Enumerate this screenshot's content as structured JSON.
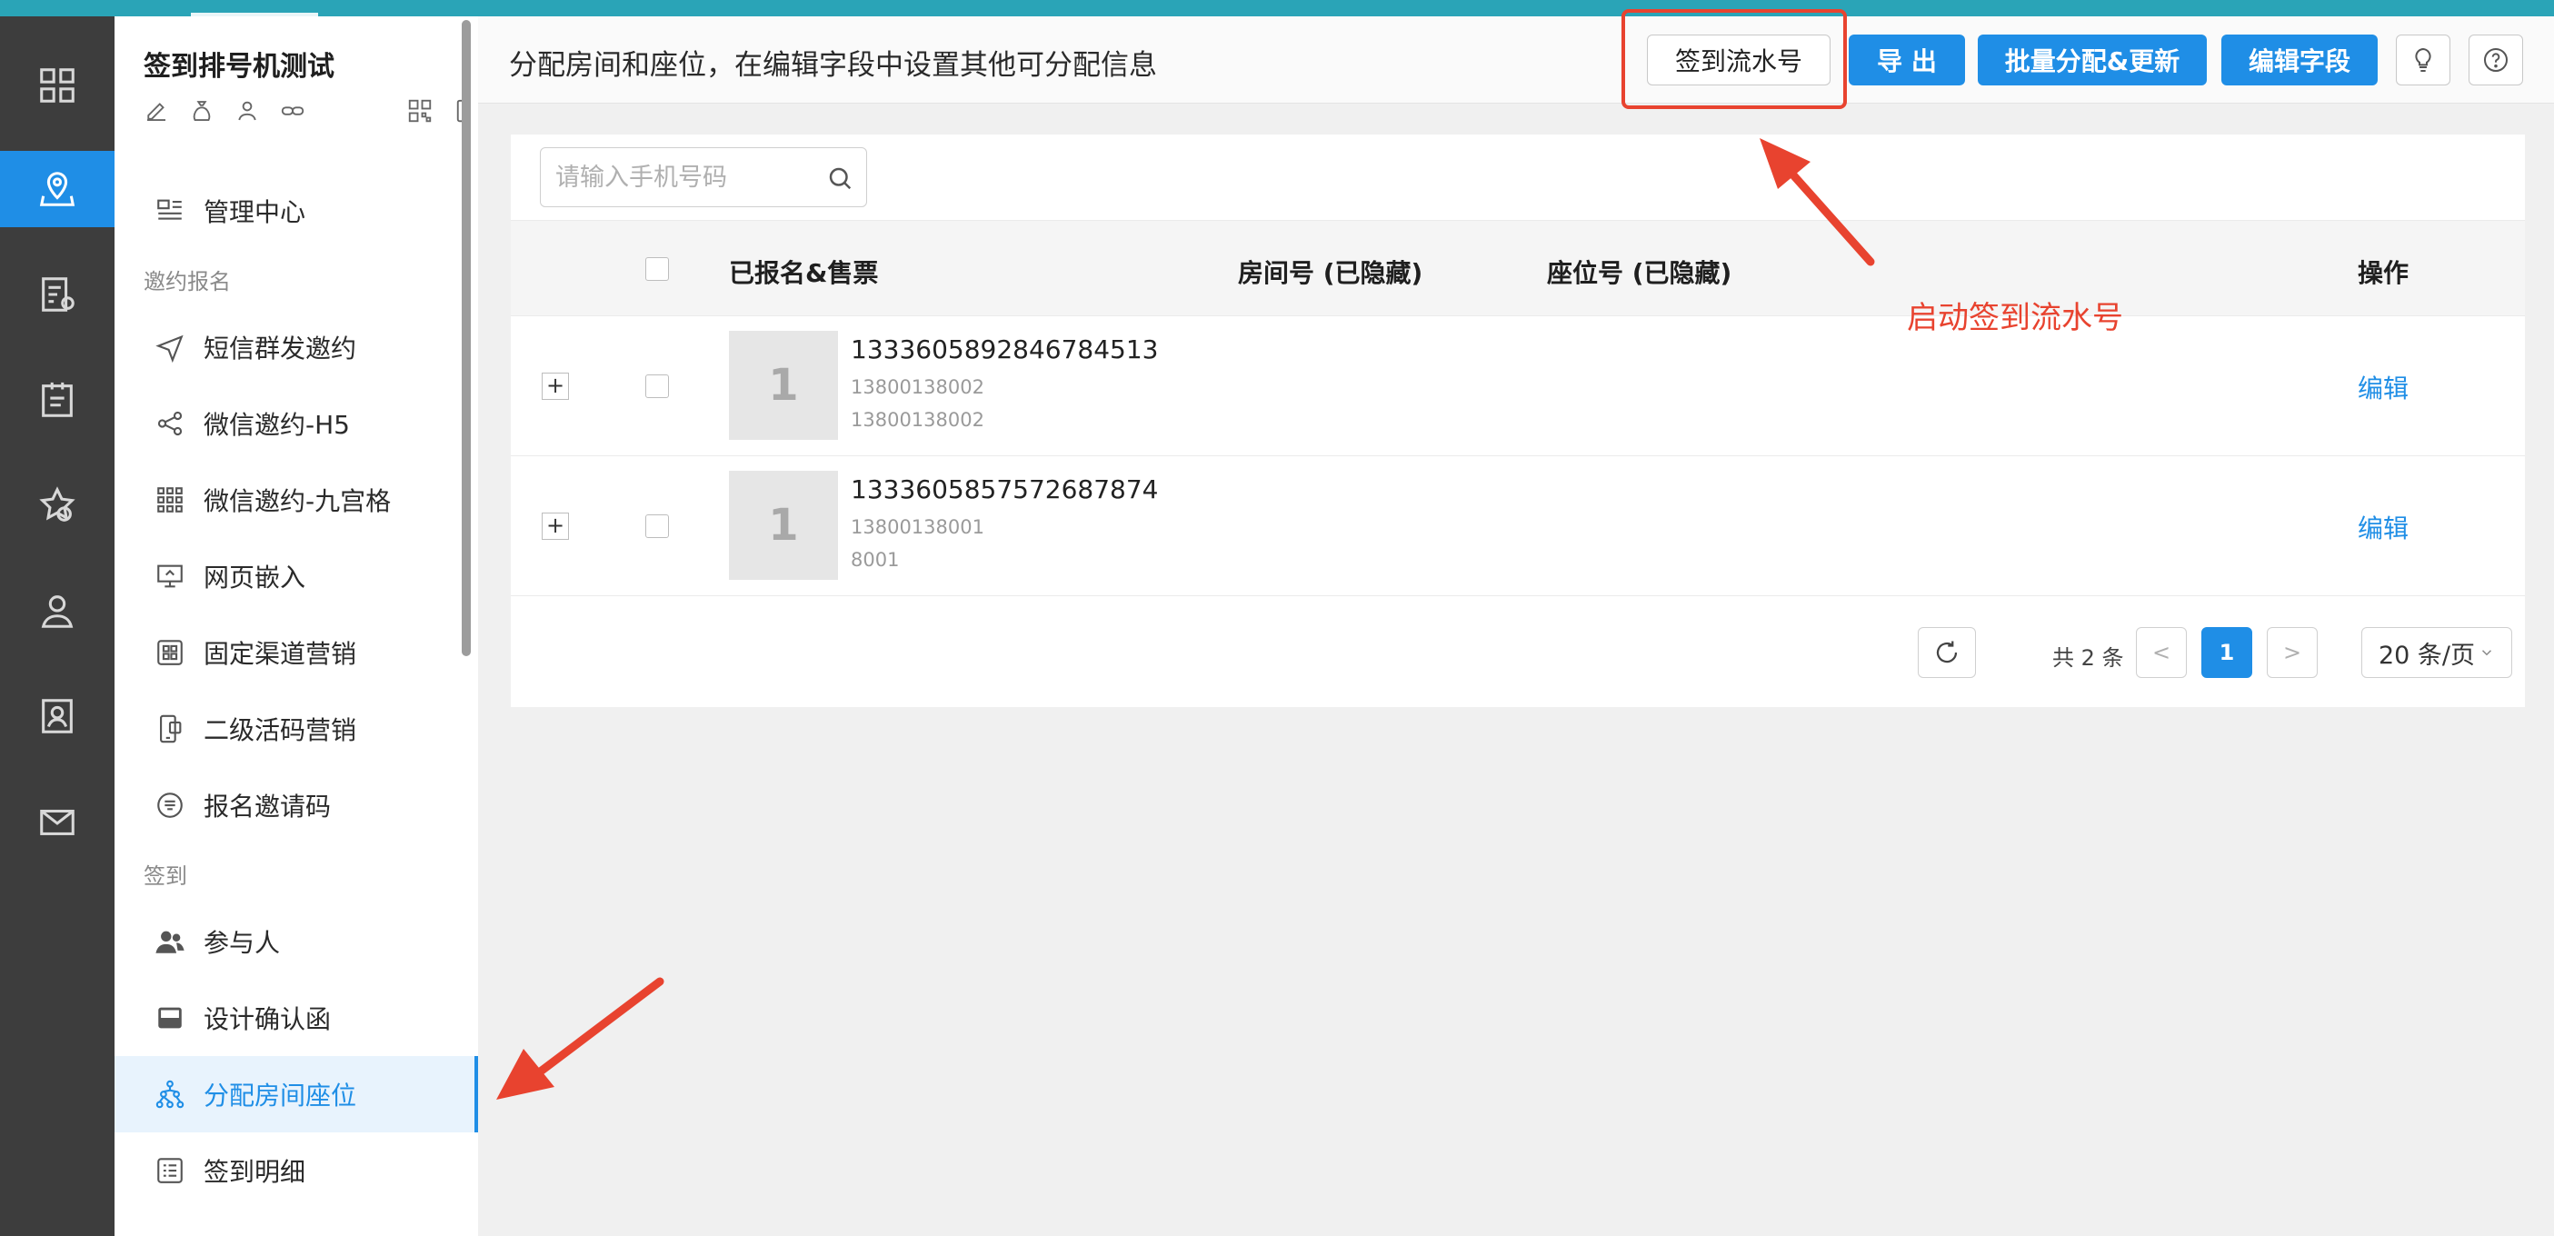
{
  "sidebar": {
    "project_title": "签到排号机测试",
    "items": [
      {
        "label": "管理中心"
      },
      {
        "label": "短信群发邀约"
      },
      {
        "label": "微信邀约-H5"
      },
      {
        "label": "微信邀约-九宫格"
      },
      {
        "label": "网页嵌入"
      },
      {
        "label": "固定渠道营销"
      },
      {
        "label": "二级活码营销"
      },
      {
        "label": "报名邀请码"
      },
      {
        "label": "参与人"
      },
      {
        "label": "设计确认函"
      },
      {
        "label": "分配房间座位"
      },
      {
        "label": "签到明细"
      }
    ],
    "sections": [
      "邀约报名",
      "签到"
    ],
    "active_color": "#1f8ee6"
  },
  "header": {
    "title": "分配房间和座位，在编辑字段中设置其他可分配信息",
    "buttons": {
      "checkin_serial": "签到流水号",
      "export": "导 出",
      "batch": "批量分配&更新",
      "edit_fields": "编辑字段"
    },
    "icons": [
      "lightbulb-icon",
      "help-icon"
    ]
  },
  "search": {
    "placeholder": "请输入手机号码"
  },
  "table": {
    "columns": [
      "已报名&售票",
      "房间号 (已隐藏)",
      "座位号 (已隐藏)",
      "操作"
    ],
    "rows": [
      {
        "thumb": "1",
        "id": "1333605892846784513",
        "line1": "13800138002",
        "line2": "13800138002",
        "action": "编辑"
      },
      {
        "thumb": "1",
        "id": "1333605857572687874",
        "line1": "13800138001",
        "line2": "8001",
        "action": "编辑"
      }
    ]
  },
  "pagination": {
    "total": "共 2 条",
    "prev": "<",
    "current": "1",
    "next": ">",
    "page_size": "20 条/页"
  },
  "annotation": {
    "text": "启动签到流水号",
    "color": "#e8432f"
  }
}
